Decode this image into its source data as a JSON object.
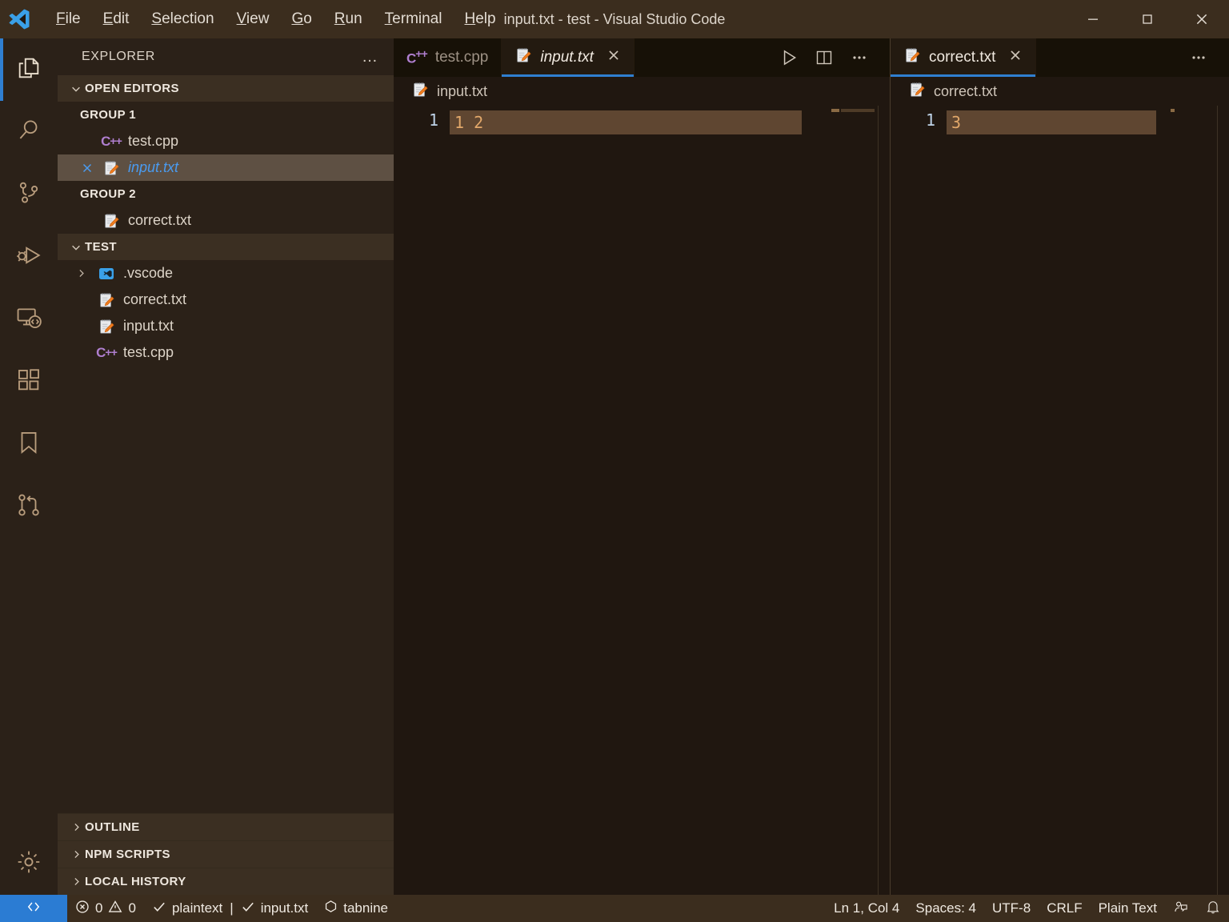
{
  "window": {
    "title": "input.txt - test - Visual Studio Code",
    "minimize": "−",
    "maximize": "☐",
    "close": "✕"
  },
  "menubar": [
    {
      "label": "File",
      "mnemonic": "F",
      "rest": "ile"
    },
    {
      "label": "Edit",
      "mnemonic": "E",
      "rest": "dit"
    },
    {
      "label": "Selection",
      "mnemonic": "S",
      "rest": "election"
    },
    {
      "label": "View",
      "mnemonic": "V",
      "rest": "iew"
    },
    {
      "label": "Go",
      "mnemonic": "G",
      "rest": "o"
    },
    {
      "label": "Run",
      "mnemonic": "R",
      "rest": "un"
    },
    {
      "label": "Terminal",
      "mnemonic": "T",
      "rest": "erminal"
    },
    {
      "label": "Help",
      "mnemonic": "H",
      "rest": "elp"
    }
  ],
  "activitybar": {
    "items": [
      {
        "name": "explorer",
        "icon": "files-icon",
        "active": true
      },
      {
        "name": "search",
        "icon": "search-icon",
        "active": false
      },
      {
        "name": "source-control",
        "icon": "source-control-icon",
        "active": false
      },
      {
        "name": "run-and-debug",
        "icon": "run-debug-icon",
        "active": false
      },
      {
        "name": "remote-explorer",
        "icon": "remote-explorer-icon",
        "active": false
      },
      {
        "name": "extensions",
        "icon": "extensions-icon",
        "active": false
      },
      {
        "name": "bookmarks",
        "icon": "bookmark-icon",
        "active": false
      },
      {
        "name": "git-graph",
        "icon": "git-compare-icon",
        "active": false
      }
    ],
    "bottom": [
      {
        "name": "manage",
        "icon": "gear-icon"
      }
    ]
  },
  "sidebar": {
    "title": "EXPLORER",
    "more_actions": "…",
    "open_editors": {
      "label": "OPEN EDITORS",
      "groups": [
        {
          "label": "GROUP 1",
          "items": [
            {
              "name": "test.cpp",
              "icon": "cpp-icon",
              "selected": false,
              "dirty": false,
              "closeable": false
            },
            {
              "name": "input.txt",
              "icon": "txt-icon",
              "selected": true,
              "dirty": false,
              "closeable": true
            }
          ]
        },
        {
          "label": "GROUP 2",
          "items": [
            {
              "name": "correct.txt",
              "icon": "txt-icon",
              "selected": false,
              "dirty": false,
              "closeable": false
            }
          ]
        }
      ]
    },
    "workspace": {
      "label": "TEST",
      "items": [
        {
          "name": ".vscode",
          "icon": "vscode-folder-icon",
          "type": "folder",
          "expanded": false
        },
        {
          "name": "correct.txt",
          "icon": "txt-icon",
          "type": "file"
        },
        {
          "name": "input.txt",
          "icon": "txt-icon",
          "type": "file"
        },
        {
          "name": "test.cpp",
          "icon": "cpp-icon",
          "type": "file"
        }
      ]
    },
    "collapsed_sections": [
      {
        "label": "OUTLINE"
      },
      {
        "label": "NPM SCRIPTS"
      },
      {
        "label": "LOCAL HISTORY"
      }
    ]
  },
  "editor_groups": [
    {
      "id": "group-1",
      "tabs": [
        {
          "label": "test.cpp",
          "icon": "cpp-icon",
          "active": false,
          "preview": false,
          "closeable": false
        },
        {
          "label": "input.txt",
          "icon": "txt-icon",
          "active": true,
          "preview": true,
          "closeable": true,
          "close_glyph": "✕"
        }
      ],
      "actions": [
        {
          "name": "run-code-button",
          "icon": "play-icon"
        },
        {
          "name": "split-editor-button",
          "icon": "split-editor-icon"
        },
        {
          "name": "more-actions-button",
          "icon": "ellipsis-icon",
          "glyph": "…"
        }
      ],
      "breadcrumb": {
        "label": "input.txt",
        "icon": "txt-icon"
      },
      "lines": [
        {
          "number": "1",
          "text": "1 2"
        }
      ]
    },
    {
      "id": "group-2",
      "tabs": [
        {
          "label": "correct.txt",
          "icon": "txt-icon",
          "active": true,
          "preview": false,
          "closeable": true,
          "close_glyph": "✕"
        }
      ],
      "actions": [
        {
          "name": "more-actions-button",
          "icon": "ellipsis-icon",
          "glyph": "…"
        }
      ],
      "breadcrumb": {
        "label": "correct.txt",
        "icon": "txt-icon"
      },
      "lines": [
        {
          "number": "1",
          "text": "3"
        }
      ]
    }
  ],
  "statusbar": {
    "remote": {
      "label": "",
      "icon": "remote-icon"
    },
    "problems": {
      "errors": "0",
      "warnings": "0",
      "error_icon": "error-icon",
      "warning_icon": "warning-icon"
    },
    "language_check": {
      "check_icon": "check-icon",
      "language": "plaintext",
      "separator": "|",
      "file": "input.txt"
    },
    "tabnine": {
      "icon": "tabnine-icon",
      "label": "tabnine"
    },
    "position": "Ln 1, Col 4",
    "indentation": "Spaces: 4",
    "encoding": "UTF-8",
    "eol": "CRLF",
    "language_mode": "Plain Text",
    "feedback_icon": "feedback-icon",
    "notifications_icon": "bell-icon"
  },
  "colors": {
    "accent_blue": "#2f7fd1",
    "titlebar_bg": "#3b2d1e",
    "sidebar_bg": "#2b2118",
    "editor_bg": "#201710",
    "selection_bg": "#5f4631",
    "code_fg": "#e2a86a",
    "remote_bg": "#2b7cd3"
  }
}
